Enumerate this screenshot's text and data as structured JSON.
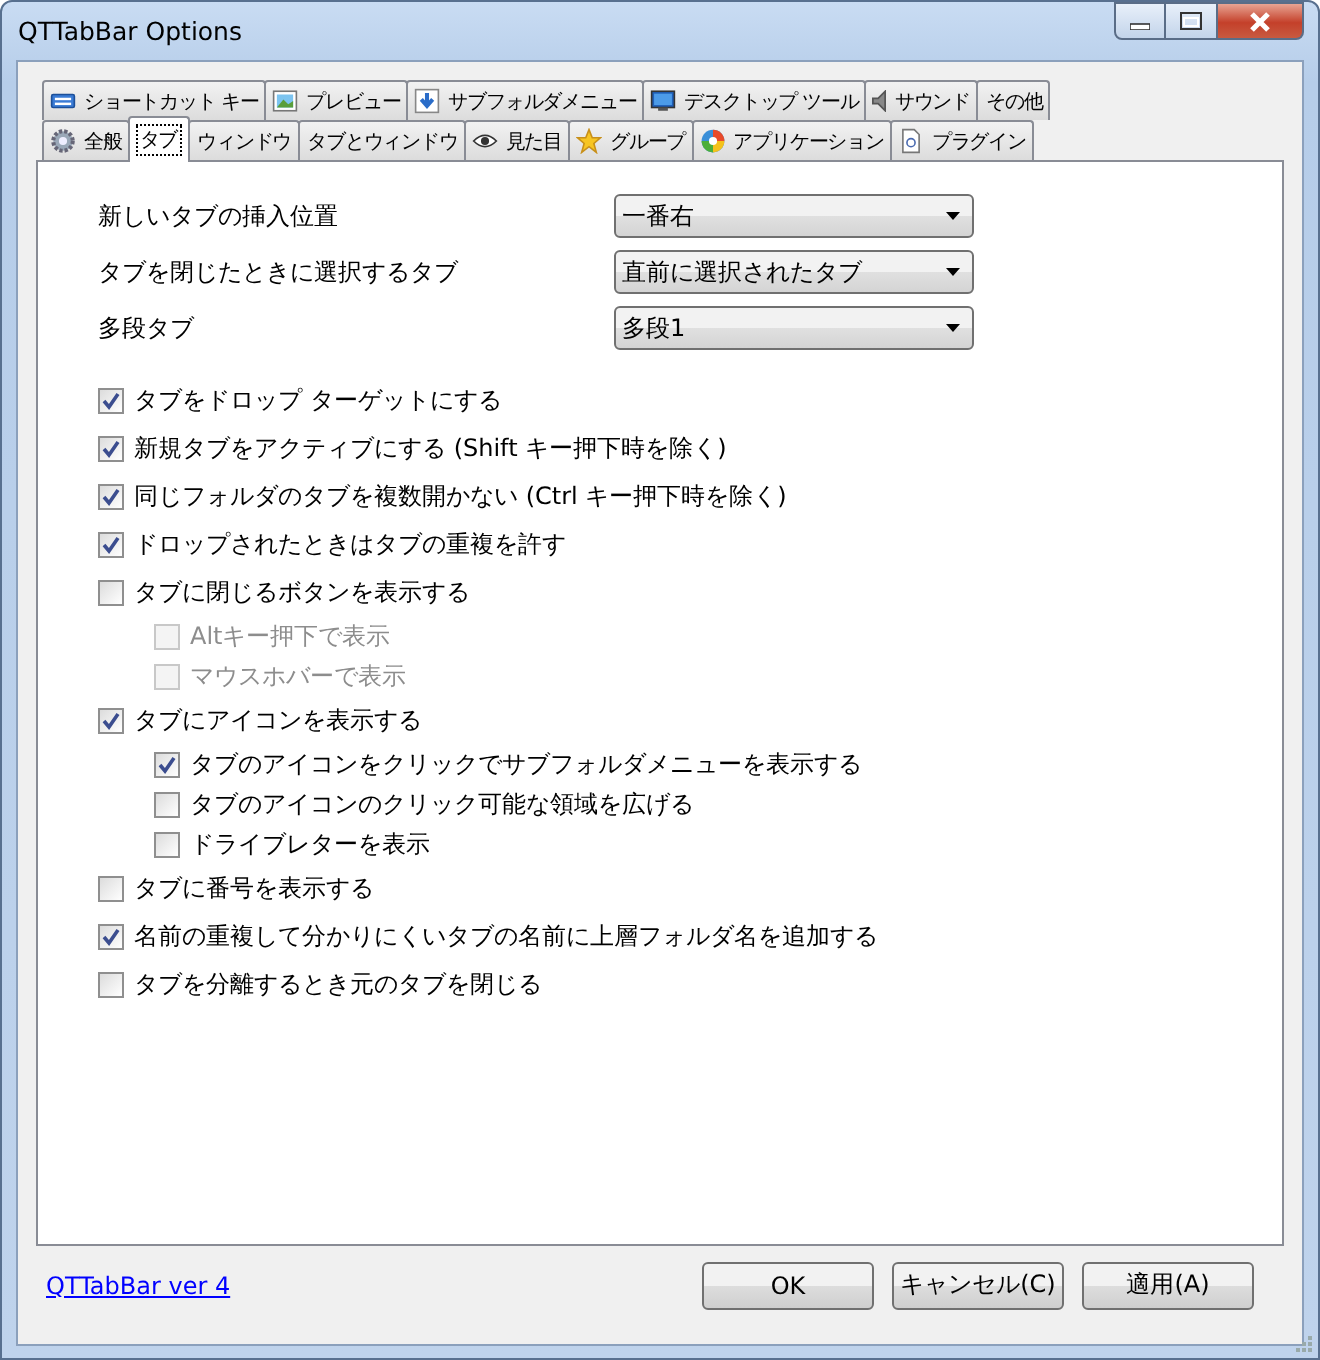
{
  "window": {
    "title": "QTTabBar Options"
  },
  "tab_rows": [
    [
      {
        "label": "ショートカット キー",
        "selected": false
      },
      {
        "label": "プレビュー",
        "selected": false
      },
      {
        "label": "サブフォルダメニュー",
        "selected": false
      },
      {
        "label": "デスクトップ ツール",
        "selected": false
      },
      {
        "label": "サウンド",
        "selected": false
      },
      {
        "label": "その他",
        "selected": false
      }
    ],
    [
      {
        "label": "全般",
        "selected": false
      },
      {
        "label": "タブ",
        "selected": true
      },
      {
        "label": "ウィンドウ",
        "selected": false
      },
      {
        "label": "タブとウィンドウ",
        "selected": false
      },
      {
        "label": "見た目",
        "selected": false
      },
      {
        "label": "グループ",
        "selected": false
      },
      {
        "label": "アプリケーション",
        "selected": false
      },
      {
        "label": "プラグイン",
        "selected": false
      }
    ]
  ],
  "settings": [
    {
      "label": "新しいタブの挿入位置",
      "value": "一番右"
    },
    {
      "label": "タブを閉じたときに選択するタブ",
      "value": "直前に選択されたタブ"
    },
    {
      "label": "多段タブ",
      "value": "多段1"
    }
  ],
  "checks": [
    {
      "label": "タブをドロップ ターゲットにする",
      "checked": true,
      "disabled": false
    },
    {
      "label": "新規タブをアクティブにする (Shift キー押下時を除く)",
      "checked": true,
      "disabled": false
    },
    {
      "label": "同じフォルダのタブを複数開かない (Ctrl キー押下時を除く)",
      "checked": true,
      "disabled": false
    },
    {
      "label": "ドロップされたときはタブの重複を許す",
      "checked": true,
      "disabled": false
    },
    {
      "label": "タブに閉じるボタンを表示する",
      "checked": false,
      "disabled": false,
      "children": [
        {
          "label": "Altキー押下で表示",
          "checked": false,
          "disabled": true
        },
        {
          "label": "マウスホバーで表示",
          "checked": false,
          "disabled": true
        }
      ]
    },
    {
      "label": "タブにアイコンを表示する",
      "checked": true,
      "disabled": false,
      "children": [
        {
          "label": "タブのアイコンをクリックでサブフォルダメニューを表示する",
          "checked": true,
          "disabled": false
        },
        {
          "label": "タブのアイコンのクリック可能な領域を広げる",
          "checked": false,
          "disabled": false
        },
        {
          "label": "ドライブレターを表示",
          "checked": false,
          "disabled": false
        }
      ]
    },
    {
      "label": "タブに番号を表示する",
      "checked": false,
      "disabled": false
    },
    {
      "label": "名前の重複して分かりにくいタブの名前に上層フォルダ名を追加する",
      "checked": true,
      "disabled": false
    },
    {
      "label": "タブを分離するとき元のタブを閉じる",
      "checked": false,
      "disabled": false
    }
  ],
  "footer": {
    "link": "QTTabBar ver 4",
    "buttons": [
      "OK",
      "キャンセル(C)",
      "適用(A)"
    ]
  }
}
